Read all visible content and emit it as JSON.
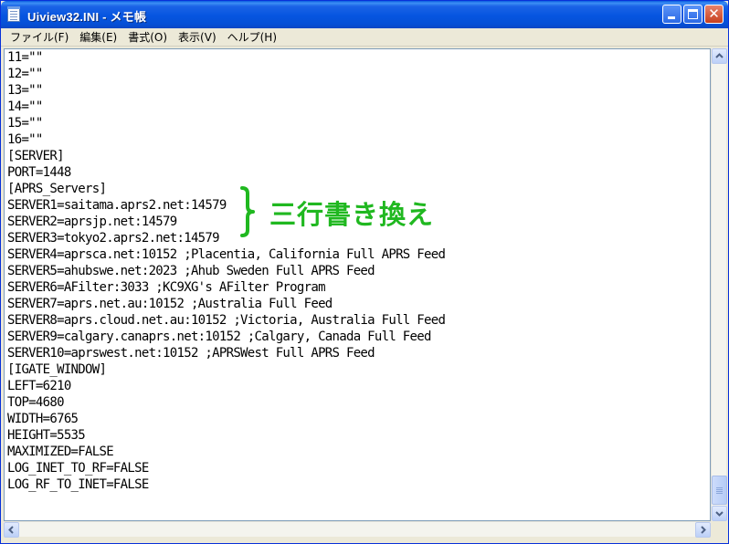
{
  "window": {
    "title": "Uiview32.INI - メモ帳",
    "close_glyph": "✕"
  },
  "menu": [
    "ファイル(F)",
    "編集(E)",
    "書式(O)",
    "表示(V)",
    "ヘルプ(H)"
  ],
  "document": {
    "lines": [
      "11=\"\"",
      "12=\"\"",
      "13=\"\"",
      "14=\"\"",
      "15=\"\"",
      "16=\"\"",
      "[SERVER]",
      "PORT=1448",
      "[APRS_Servers]",
      "SERVER1=saitama.aprs2.net:14579",
      "SERVER2=aprsjp.net:14579",
      "SERVER3=tokyo2.aprs2.net:14579",
      "SERVER4=aprsca.net:10152 ;Placentia, California Full APRS Feed",
      "SERVER5=ahubswe.net:2023 ;Ahub Sweden Full APRS Feed",
      "SERVER6=AFilter:3033 ;KC9XG's AFilter Program",
      "SERVER7=aprs.net.au:10152 ;Australia Full Feed",
      "SERVER8=aprs.cloud.net.au:10152 ;Victoria, Australia Full Feed",
      "SERVER9=calgary.canaprs.net:10152 ;Calgary, Canada Full Feed",
      "SERVER10=aprswest.net:10152 ;APRSWest Full APRS Feed",
      "[IGATE_WINDOW]",
      "LEFT=6210",
      "TOP=4680",
      "WIDTH=6765",
      "HEIGHT=5535",
      "MAXIMIZED=FALSE",
      "LOG_INET_TO_RF=FALSE",
      "LOG_RF_TO_INET=FALSE"
    ]
  },
  "annotation": {
    "text": "三行書き換え",
    "color": "#20b820"
  },
  "icons": {
    "window": "notepad-icon",
    "minimize": "minimize-icon",
    "maximize": "maximize-icon",
    "close": "close-icon",
    "brace": "curly-brace-icon"
  }
}
